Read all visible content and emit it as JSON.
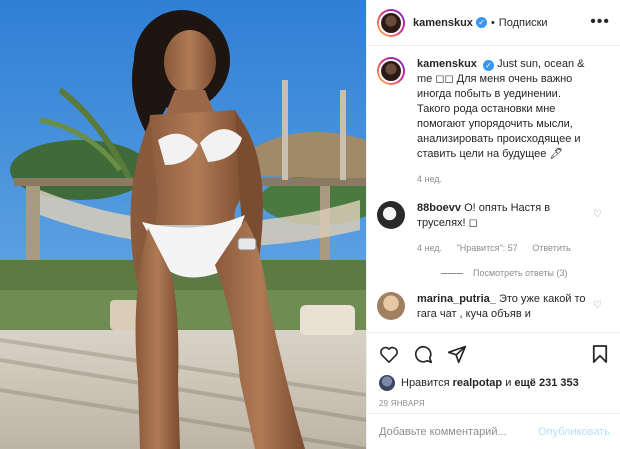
{
  "header": {
    "username": "kamenskux",
    "verified_mark": "✓",
    "separator": "•",
    "follow_label": "Подписки",
    "more_label": "•••"
  },
  "caption": {
    "username": "kamenskux",
    "verified_mark": "✓",
    "text": "Just sun, ocean & me ◻◻ Для меня очень важно иногда побыть в уединении. Такого рода остановки мне помогают упорядочить мысли, анализировать происходящее и ставить цели на будущее 🖋",
    "time": "4 нед."
  },
  "comments": [
    {
      "username": "88boevv",
      "text": "О! опять Настя в труселях! ◻",
      "time": "4 нед.",
      "likes": "\"Нравится\": 57",
      "reply_label": "Ответить",
      "view_replies": "Посмотреть ответы (3)"
    },
    {
      "username": "marina_putria_",
      "text": "Это уже какой то гага чат , куча объяв и"
    }
  ],
  "likes": {
    "prefix": "Нравится",
    "user": "realpotap",
    "connector": "и",
    "count": "ещё 231 353"
  },
  "date": "29 ЯНВАРЯ",
  "add_comment": {
    "placeholder": "Добавьте комментарий...",
    "publish_label": "Опубликовать"
  },
  "colors": {
    "accent": "#3897f0",
    "muted": "#8e8e8e",
    "publish_disabled": "#b2dffc"
  }
}
